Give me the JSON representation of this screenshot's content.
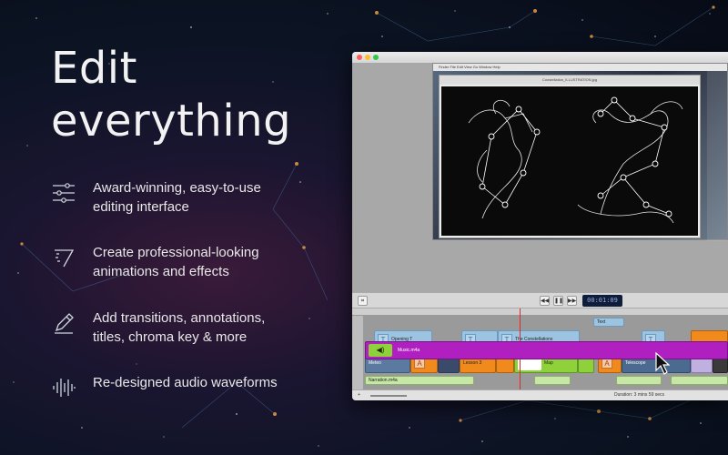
{
  "headline": {
    "line1": "Edit",
    "line2": "everything"
  },
  "features": [
    {
      "icon": "sliders-icon",
      "text": "Award-winning, easy-to-use editing interface"
    },
    {
      "icon": "animation-icon",
      "text": "Create professional-looking animations and effects"
    },
    {
      "icon": "pencil-icon",
      "text": "Add transitions, annotations, titles, chroma key & more"
    },
    {
      "icon": "waveform-icon",
      "text": "Re-designed audio waveforms"
    }
  ],
  "app": {
    "inner_menu": "Finder  File  Edit  View  Go  Window  Help",
    "inner_doc_title": "Constellation_ILLUSTRATION.jpg",
    "timecode": "00:01:09",
    "clips": {
      "title1": "Opening T",
      "title2": "The Constellations",
      "title3": "Text",
      "media1": "Meteo",
      "media2": "Lesson 3",
      "media3": "Map",
      "media4": "Telescope",
      "audio1": "Narration.m4a",
      "audio2": "Music.m4a"
    },
    "duration": "Duration: 3 mins 59 secs"
  },
  "colors": {
    "accent_orange": "#f08a1c",
    "accent_green": "#8fd13a",
    "accent_magenta": "#b020c0",
    "title_blue": "#9cc4e0"
  }
}
